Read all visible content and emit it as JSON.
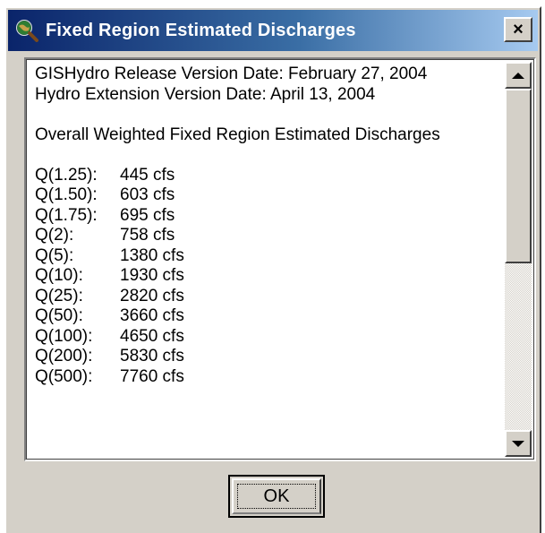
{
  "window": {
    "title": "Fixed Region Estimated Discharges",
    "close_label": "×",
    "app_icon": "globe-magnifier-icon"
  },
  "content": {
    "release_line": "GISHydro Release Version Date: February 27, 2004",
    "extension_line": "Hydro Extension Version Date:  April 13, 2004",
    "heading": "Overall Weighted Fixed Region Estimated Discharges",
    "discharges": [
      {
        "label": "Q(1.25):",
        "value": "445 cfs"
      },
      {
        "label": "Q(1.50):",
        "value": "603 cfs"
      },
      {
        "label": "Q(1.75):",
        "value": "695 cfs"
      },
      {
        "label": "Q(2):",
        "value": "758 cfs"
      },
      {
        "label": "Q(5):",
        "value": "1380 cfs"
      },
      {
        "label": "Q(10):",
        "value": "1930 cfs"
      },
      {
        "label": "Q(25):",
        "value": "2820 cfs"
      },
      {
        "label": "Q(50):",
        "value": "3660 cfs"
      },
      {
        "label": "Q(100):",
        "value": "4650 cfs"
      },
      {
        "label": "Q(200):",
        "value": "5830 cfs"
      },
      {
        "label": "Q(500):",
        "value": "7760 cfs"
      }
    ]
  },
  "buttons": {
    "ok_label": "OK"
  },
  "colors": {
    "titlebar_start": "#0a246a",
    "titlebar_end": "#a6caf0",
    "window_face": "#d4d0c8"
  }
}
